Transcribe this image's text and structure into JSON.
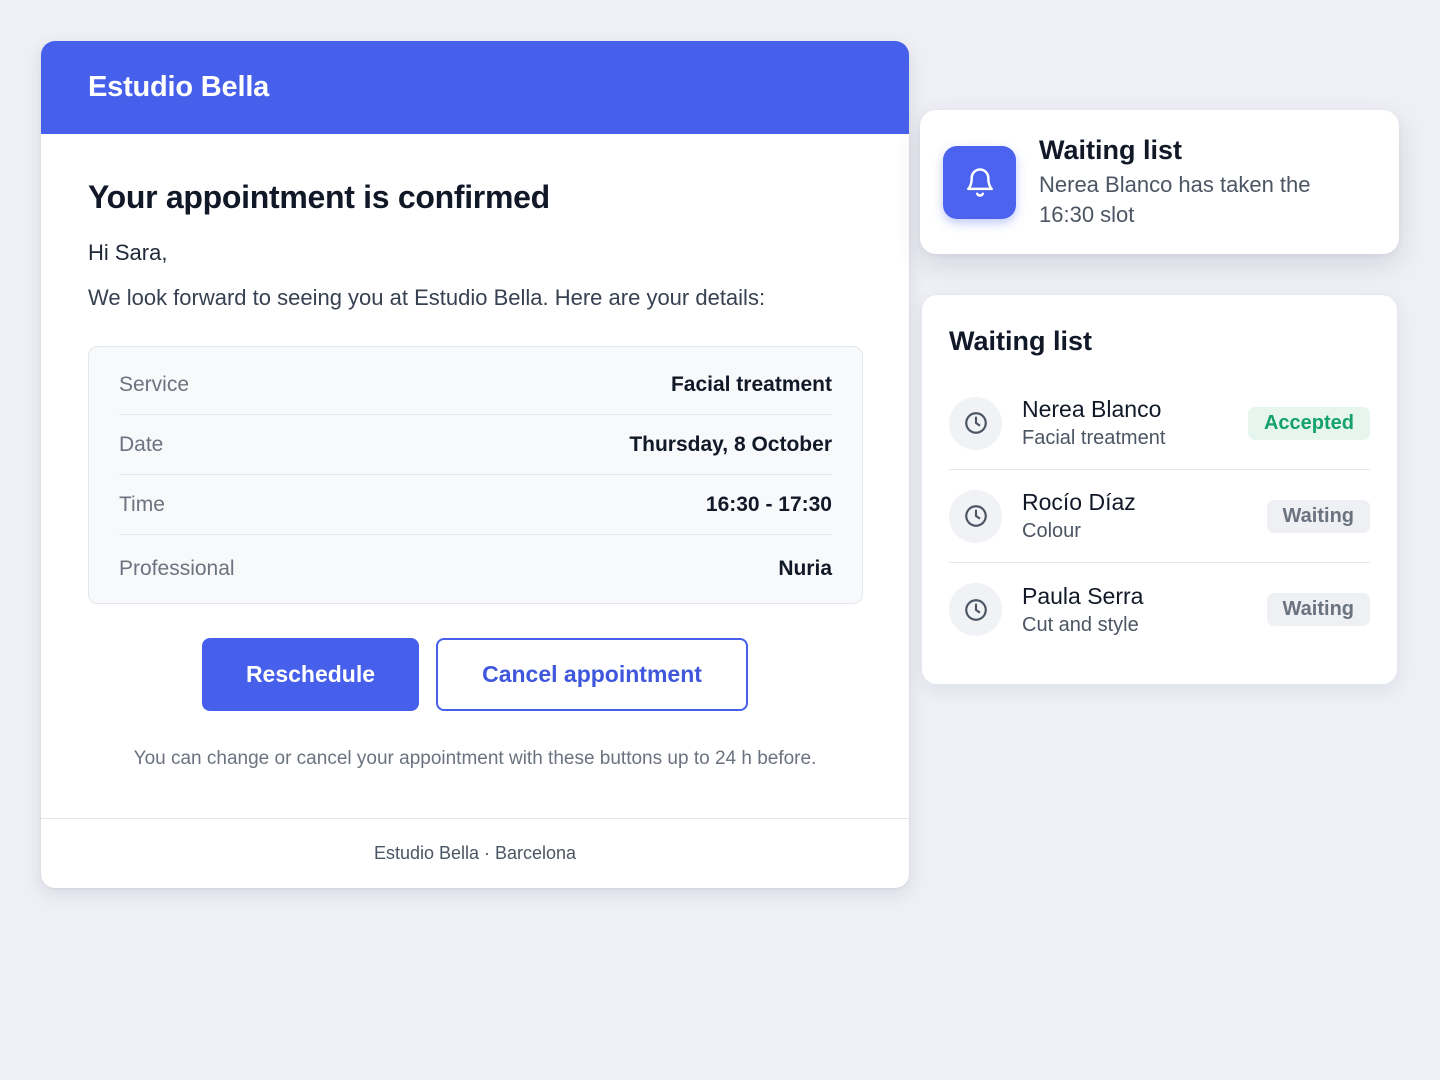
{
  "email": {
    "brand": "Estudio Bella",
    "title": "Your appointment is confirmed",
    "greeting": "Hi Sara,",
    "intro": "We look forward to seeing you at Estudio Bella. Here are your details:",
    "details": [
      {
        "label": "Service",
        "value": "Facial treatment"
      },
      {
        "label": "Date",
        "value": "Thursday, 8 October"
      },
      {
        "label": "Time",
        "value": "16:30 - 17:30"
      },
      {
        "label": "Professional",
        "value": "Nuria"
      }
    ],
    "reschedule_label": "Reschedule",
    "cancel_label": "Cancel appointment",
    "note": "You can change or cancel your appointment with these buttons up to 24 h before.",
    "footer": "Estudio Bella · Barcelona"
  },
  "notification": {
    "icon": "bell-icon",
    "title": "Waiting list",
    "message": "Nerea Blanco has taken the 16:30 slot"
  },
  "waiting_list": {
    "title": "Waiting list",
    "items": [
      {
        "name": "Nerea Blanco",
        "service": "Facial treatment",
        "status": "Accepted",
        "icon": "clock-icon"
      },
      {
        "name": "Rocío Díaz",
        "service": "Colour",
        "status": "Waiting",
        "icon": "clock-icon"
      },
      {
        "name": "Paula Serra",
        "service": "Cut and style",
        "status": "Waiting",
        "icon": "clock-icon"
      }
    ]
  },
  "colors": {
    "brand": "#4760ec",
    "accepted_text": "#15a26a",
    "accepted_bg": "#e6f6ef",
    "waiting_text": "#6b7280",
    "waiting_bg": "#eef0f3",
    "background": "#eff0f6"
  }
}
